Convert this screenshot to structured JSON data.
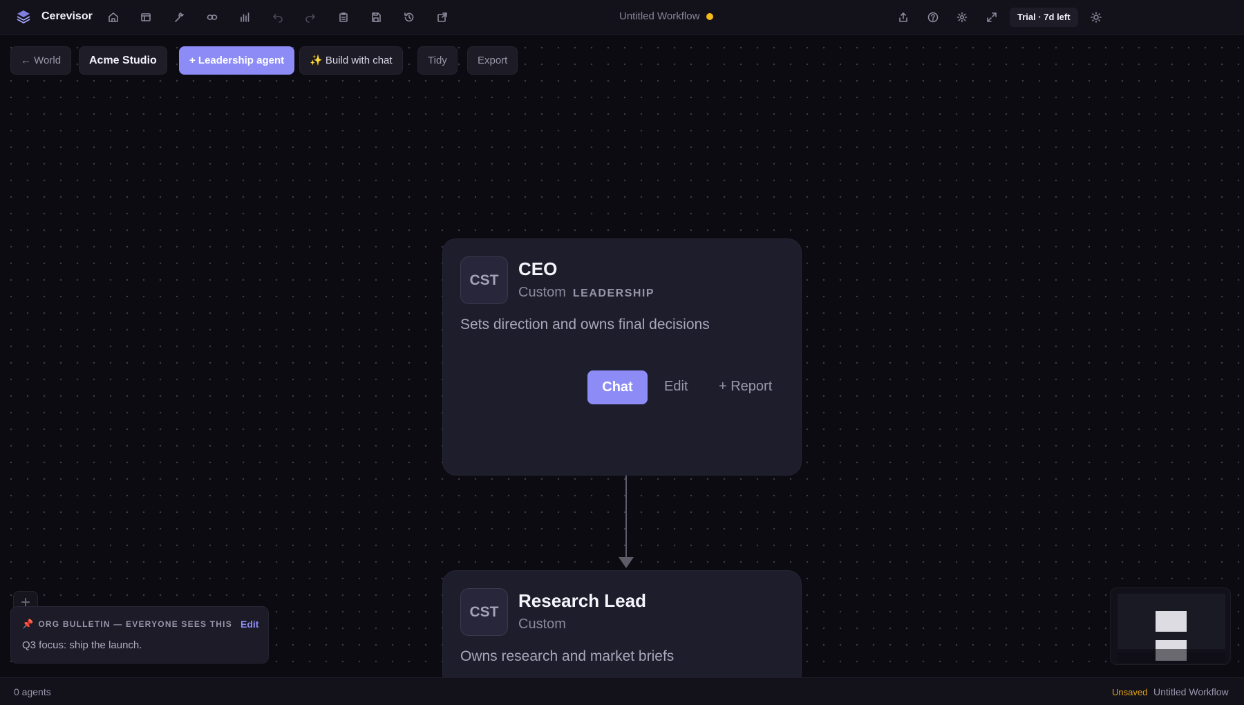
{
  "app": {
    "name": "Cerevisor"
  },
  "topbar": {
    "workflow_title": "Untitled Workflow",
    "trial_badge": "Trial · 7d left",
    "icons": [
      "home-icon",
      "layout-icon",
      "wrench-icon",
      "link-icon",
      "bar-chart-icon",
      "undo-icon",
      "redo-icon",
      "clipboard-icon",
      "save-icon",
      "history-icon",
      "external-icon",
      "share-icon",
      "help-icon",
      "gear-icon",
      "expand-icon",
      "sun-icon"
    ]
  },
  "toolbar": {
    "back_world": "← World",
    "studio": "Acme Studio",
    "add_leadership_agent": "+ Leadership agent",
    "build_with_chat": "✨ Build with chat",
    "tidy": "Tidy",
    "export": "Export"
  },
  "nodes": [
    {
      "avatar": "CST",
      "title": "CEO",
      "type": "Custom",
      "tag": "LEADERSHIP",
      "description": "Sets direction and owns final decisions",
      "actions": {
        "chat": "Chat",
        "edit": "Edit",
        "report": "+ Report"
      }
    },
    {
      "avatar": "CST",
      "title": "Research Lead",
      "type": "Custom",
      "description": "Owns research and market briefs"
    }
  ],
  "bulletin": {
    "add": "+",
    "heading": "ORG BULLETIN — EVERYONE SEES THIS",
    "edit": "Edit",
    "body": "Q3 focus: ship the launch."
  },
  "statusbar": {
    "agents": "0 agents",
    "unsaved": "Unsaved",
    "workflow": "Untitled Workflow"
  },
  "colors": {
    "accent": "#8d8cf6",
    "status_dot": "#f5b91a",
    "unsaved": "#e0a11c",
    "background": "#0c0b12",
    "card": "#1e1d2b"
  }
}
